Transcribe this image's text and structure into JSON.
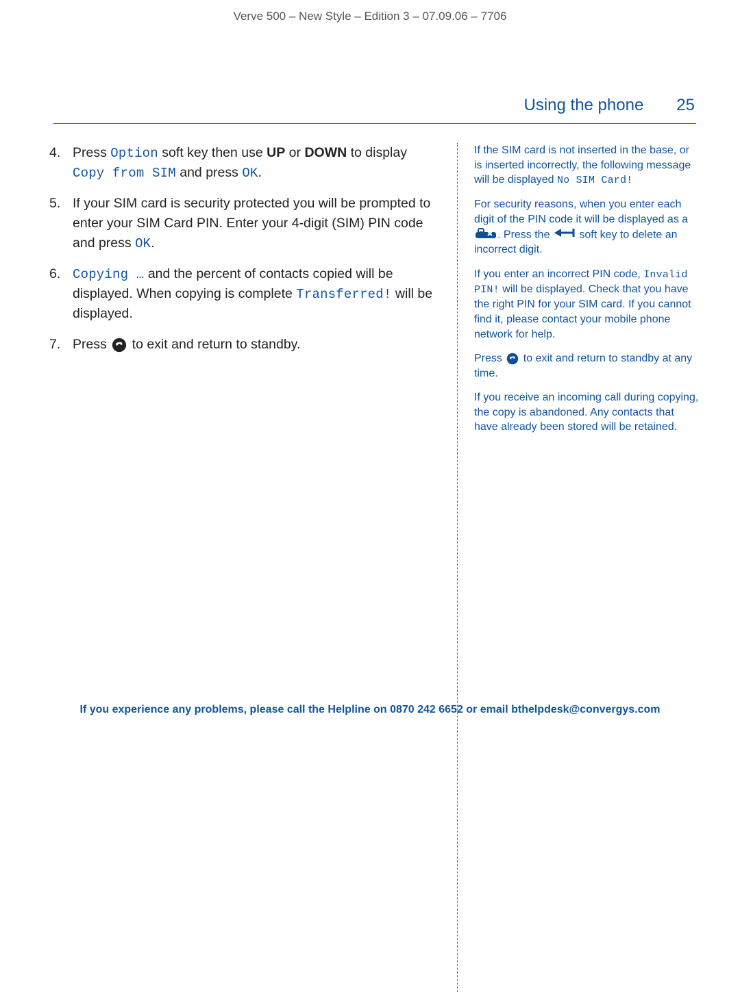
{
  "header": {
    "doc_title": "Verve 500 – New Style – Edition 3 – 07.09.06 – 7706"
  },
  "section": {
    "title": "Using the phone",
    "page_number": "25"
  },
  "steps": {
    "s4": {
      "num": "4.",
      "t1": "Press ",
      "code1": "Option",
      "t2": " soft key then use ",
      "b1": "UP",
      "t3": " or ",
      "b2": "DOWN",
      "t4": " to display ",
      "code2": "Copy from SIM",
      "t5": " and press ",
      "code3": "OK",
      "t6": "."
    },
    "s5": {
      "num": "5.",
      "t1": "If your SIM card is security protected you will be prompted to enter your SIM Card PIN. Enter your 4-digit (SIM) PIN code and press ",
      "code1": "OK",
      "t2": "."
    },
    "s6": {
      "num": "6.",
      "code1": "Copying …",
      "t1": " and the percent of contacts copied will be displayed. When copying is complete ",
      "code2": "Transferred!",
      "t2": " will be displayed."
    },
    "s7": {
      "num": "7.",
      "t1": "Press ",
      "t2": " to exit and return to standby."
    }
  },
  "side": {
    "p1": {
      "t1": "If the SIM card is not inserted in the base, or is inserted incorrectly, the following message will be displayed ",
      "code1": "No SIM Card!"
    },
    "p2": {
      "t1": "For security reasons, when you enter each digit of the PIN code it will be displayed as a ",
      "t2": ". Press the ",
      "t3": " soft  key to delete an incorrect digit."
    },
    "p3": {
      "t1": "If you enter an incorrect PIN code, ",
      "code1": "Invalid PIN!",
      "t2": " will be displayed. Check that you have the right PIN for your SIM card. If you cannot find it, please contact your mobile phone network for help."
    },
    "p4": {
      "t1": "Press ",
      "t2": " to exit and return to standby at any time."
    },
    "p5": {
      "t1": "If you receive an incoming call during copying, the copy is abandoned. Any contacts that have already been stored will be retained."
    }
  },
  "footer": {
    "text": "If you experience any problems, please call the Helpline on 0870 242 6652 or email bthelpdesk@convergys.com"
  }
}
